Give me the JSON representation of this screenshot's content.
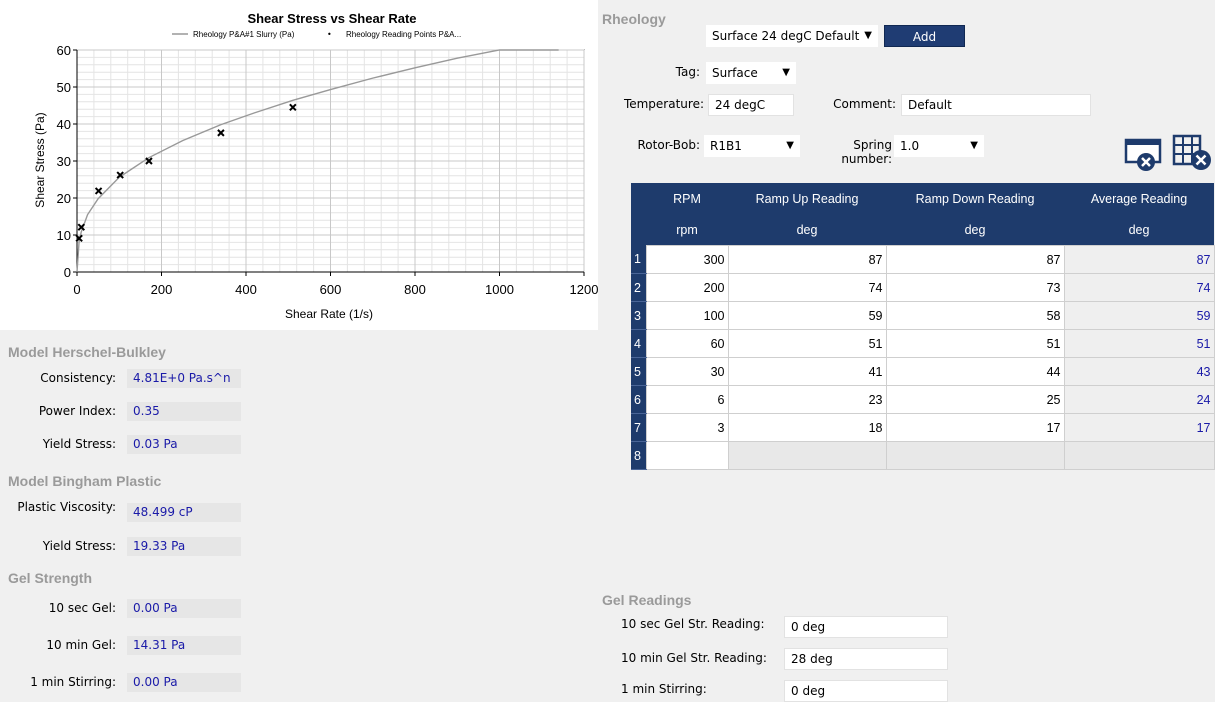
{
  "chart_data": {
    "type": "scatter",
    "title": "Shear Stress vs Shear Rate",
    "xlabel": "Shear Rate (1/s)",
    "ylabel": "Shear Stress (Pa)",
    "xlim": [
      0,
      1200
    ],
    "ylim": [
      0,
      60
    ],
    "xticks": [
      0,
      200,
      400,
      600,
      800,
      1000,
      1200
    ],
    "yticks": [
      0,
      10,
      20,
      30,
      40,
      50,
      60
    ],
    "legend": [
      "Rheology P&A#1 Slurry (Pa)",
      "Rheology Reading Points P&A..."
    ],
    "grid": true,
    "series": [
      {
        "name": "Rheology P&A#1 Slurry (Pa)",
        "type": "line",
        "color": "#999999",
        "x": [
          0,
          5,
          10,
          25,
          50,
          100,
          170,
          250,
          340,
          420,
          511,
          600,
          700,
          800,
          900,
          1000,
          1140
        ],
        "y": [
          0.03,
          8.3,
          10.8,
          15.5,
          19.8,
          25.6,
          30.9,
          35.5,
          39.8,
          43.0,
          46.4,
          49.3,
          52.4,
          55.2,
          57.8,
          60.3,
          63.5
        ]
      },
      {
        "name": "Rheology Reading Points P&A...",
        "type": "scatter",
        "color": "#000000",
        "x": [
          5.1,
          10.2,
          51.1,
          102.2,
          170.3,
          340.6,
          510.9
        ],
        "y": [
          9.1,
          12.1,
          21.9,
          26.2,
          30.0,
          37.6,
          44.5
        ]
      }
    ]
  },
  "model_hb": {
    "title": "Model Herschel-Bulkley",
    "consistency_label": "Consistency:",
    "consistency_value": "4.81E+0 Pa.s^n",
    "power_label": "Power Index:",
    "power_value": "0.35",
    "yield_label": "Yield Stress:",
    "yield_value": "0.03 Pa"
  },
  "model_bp": {
    "title": "Model Bingham Plastic",
    "pv_label": "Plastic Viscosity:",
    "pv_value": "48.499 cP",
    "yield_label": "Yield Stress:",
    "yield_value": "19.33 Pa"
  },
  "gel_strength": {
    "title": "Gel Strength",
    "g10s_label": "10 sec Gel:",
    "g10s_value": "0.00 Pa",
    "g10m_label": "10 min Gel:",
    "g10m_value": "14.31 Pa",
    "g1m_label": "1 min Stirring:",
    "g1m_value": "0.00 Pa"
  },
  "rheology": {
    "title": "Rheology",
    "preset_select": "Surface 24 degC Default",
    "add_label": "Add",
    "tag_label": "Tag:",
    "tag_value": "Surface",
    "temp_label": "Temperature:",
    "temp_value": "24 degC",
    "comment_label": "Comment:",
    "comment_value": "Default",
    "rotor_label": "Rotor-Bob:",
    "rotor_value": "R1B1",
    "spring_label": "Spring number:",
    "spring_value": "1.0",
    "headers": [
      "RPM",
      "Ramp Up Reading",
      "Ramp Down Reading",
      "Average Reading"
    ],
    "units": [
      "rpm",
      "deg",
      "deg",
      "deg"
    ],
    "rows": [
      {
        "n": "1",
        "rpm": "300",
        "up": "87",
        "down": "87",
        "avg": "87"
      },
      {
        "n": "2",
        "rpm": "200",
        "up": "74",
        "down": "73",
        "avg": "74"
      },
      {
        "n": "3",
        "rpm": "100",
        "up": "59",
        "down": "58",
        "avg": "59"
      },
      {
        "n": "4",
        "rpm": "60",
        "up": "51",
        "down": "51",
        "avg": "51"
      },
      {
        "n": "5",
        "rpm": "30",
        "up": "41",
        "down": "44",
        "avg": "43"
      },
      {
        "n": "6",
        "rpm": "6",
        "up": "23",
        "down": "25",
        "avg": "24"
      },
      {
        "n": "7",
        "rpm": "3",
        "up": "18",
        "down": "17",
        "avg": "17"
      }
    ],
    "empty_row_n": "8"
  },
  "gel_readings": {
    "title": "Gel Readings",
    "r10s_label": "10 sec Gel Str. Reading:",
    "r10s_value": "0 deg",
    "r10m_label": "10 min Gel Str. Reading:",
    "r10m_value": "28 deg",
    "r1m_label": "1 min Stirring:",
    "r1m_value": "0 deg"
  },
  "colors": {
    "header_blue": "#1e3b6c",
    "value_blue": "#1a1aa8",
    "section_gray": "#9a9a9a"
  }
}
